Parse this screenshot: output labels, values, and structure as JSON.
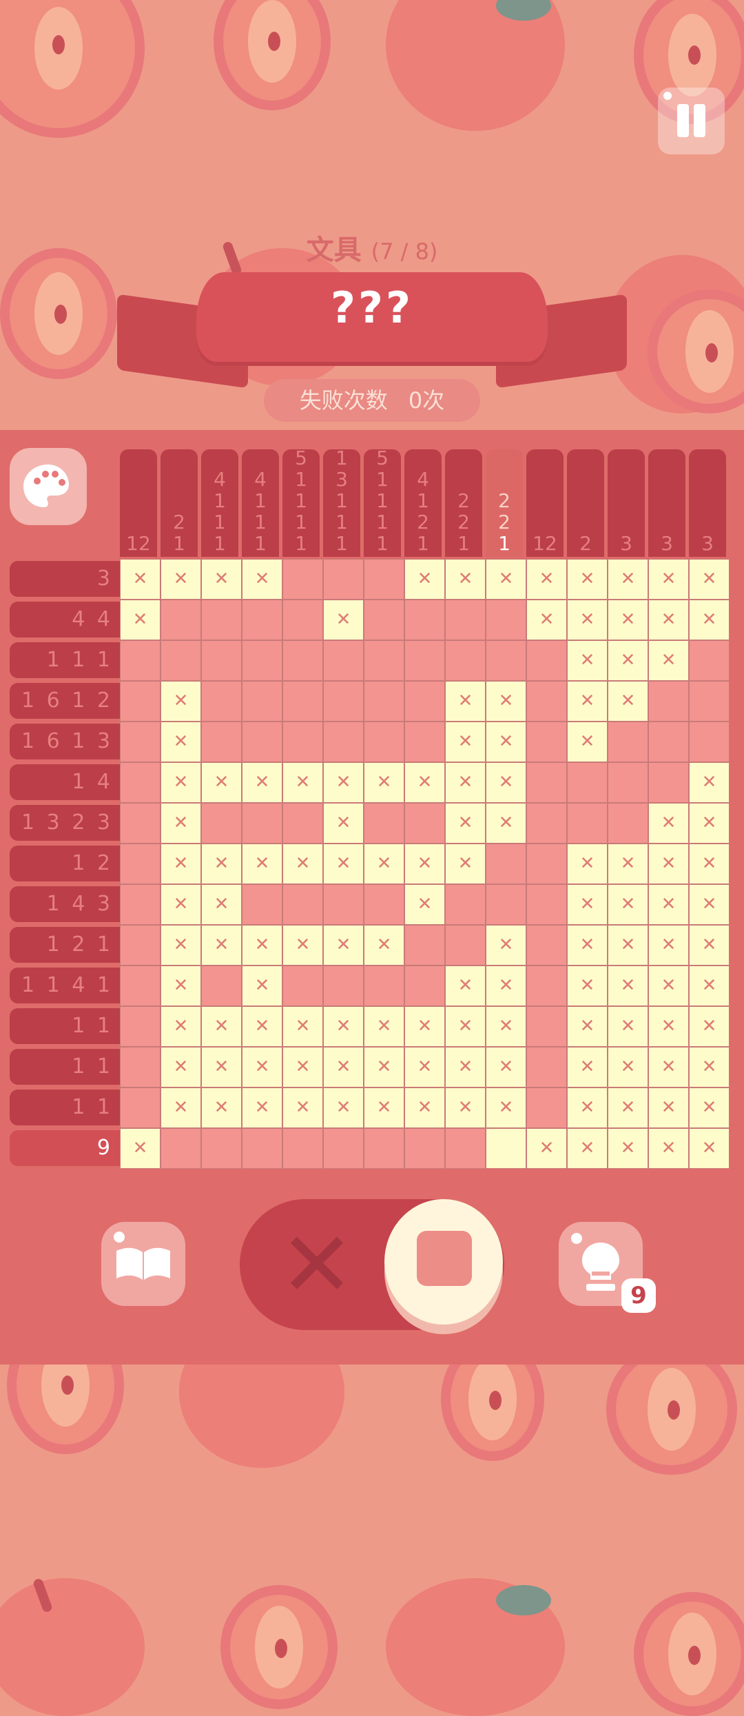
{
  "header": {
    "category": "文具",
    "progress": "(7 / 8)",
    "puzzle_name": "???",
    "fail_label": "失败次数",
    "fail_value": "0次"
  },
  "hint": {
    "count": "9"
  },
  "colors": {
    "accent": "#d9525a",
    "filled": "#f39490",
    "crossed": "#fefccb"
  },
  "icons": [
    "pause-icon",
    "palette-icon",
    "book-icon",
    "x-mode-icon",
    "fill-mode-icon",
    "hint-lightbulb-icon"
  ],
  "puzzle": {
    "active_column": 9,
    "active_row": 14,
    "col_clues": [
      [
        "12"
      ],
      [
        "2",
        "1"
      ],
      [
        "4",
        "1",
        "1",
        "1"
      ],
      [
        "4",
        "1",
        "1",
        "1"
      ],
      [
        "5",
        "1",
        "1",
        "1",
        "1"
      ],
      [
        "1",
        "3",
        "1",
        "1",
        "1"
      ],
      [
        "5",
        "1",
        "1",
        "1",
        "1"
      ],
      [
        "4",
        "1",
        "2",
        "1"
      ],
      [
        "2",
        "2",
        "1"
      ],
      [
        "2",
        "2",
        "1"
      ],
      [
        "12"
      ],
      [
        "2"
      ],
      [
        "3"
      ],
      [
        "3"
      ],
      [
        "3"
      ]
    ],
    "row_clues": [
      "3",
      "44",
      "111",
      "1612",
      "1613",
      "14",
      "1323",
      "12",
      "143",
      "121",
      "1141",
      "11",
      "11",
      "11",
      "9"
    ],
    "grid": [
      "XXXXEEEXXXXXXXX",
      "XEEEEXEEEEXXXXX",
      "EEEEEEEEEEEXXXE",
      "EXEEEEEEXXEXXEE",
      "EXEEEEEEXXEXEEE",
      "EXXXXXXXXXEEEEX",
      "EXEEEXEEXXEEEXX",
      "EXXXXXXXXEEXXXX",
      "EXXEEEEXEEEXXXX",
      "EXXXXXXEEXEXXXX",
      "EXEXEEEEXXEXXXX",
      "EXXXXXXXXXEXXXX",
      "EXXXXXXXXXEXXXX",
      "EXXXXXXXXXEXXXX",
      "XEEEEEEEEBXXXXX"
    ]
  }
}
